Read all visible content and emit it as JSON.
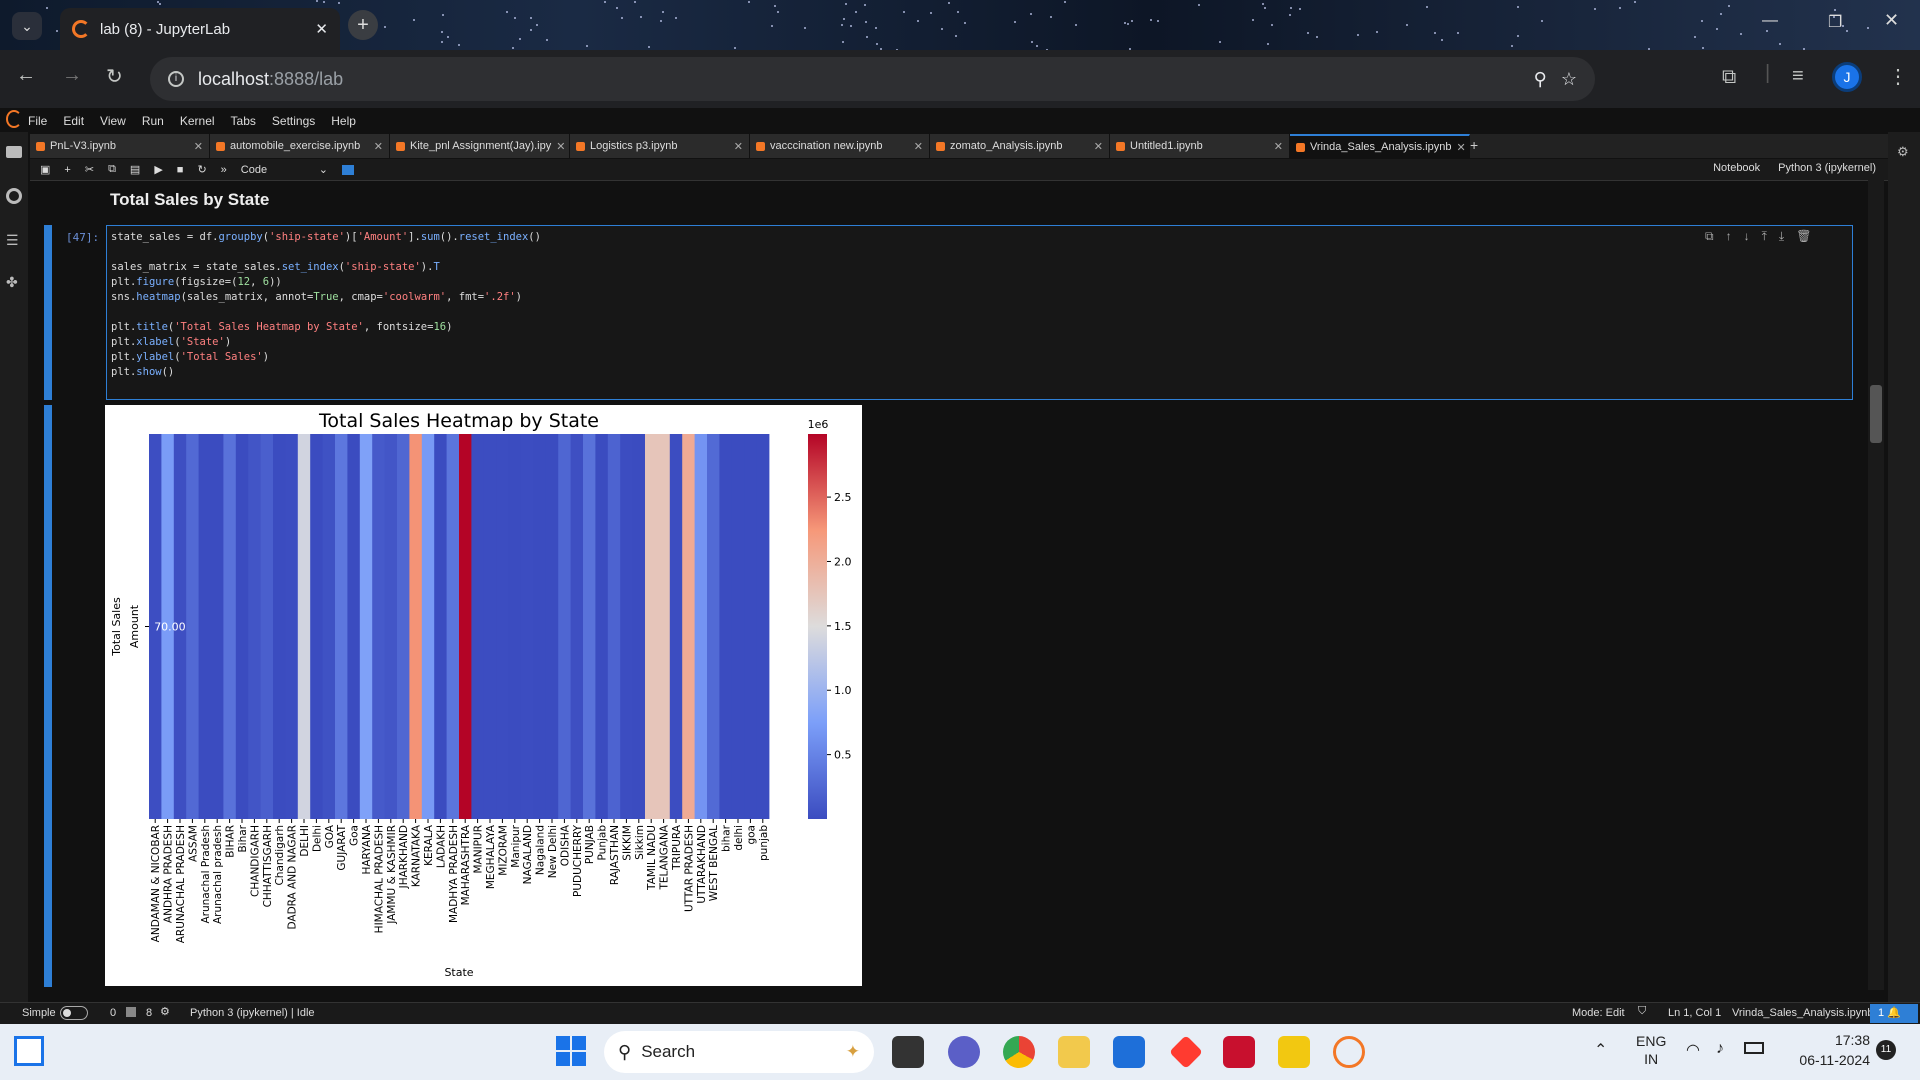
{
  "browser": {
    "tab_title": "lab (8) - JupyterLab",
    "url_host": "localhost",
    "url_rest": ":8888/lab",
    "profile_initial": "J"
  },
  "menubar": [
    "File",
    "Edit",
    "View",
    "Run",
    "Kernel",
    "Tabs",
    "Settings",
    "Help"
  ],
  "doc_tabs": [
    {
      "label": "PnL-V3.ipynb",
      "active": false
    },
    {
      "label": "automobile_exercise.ipynb",
      "active": false
    },
    {
      "label": "Kite_pnl Assignment(Jay).ipy",
      "active": false
    },
    {
      "label": "Logistics p3.ipynb",
      "active": false
    },
    {
      "label": "vacccination new.ipynb",
      "active": false
    },
    {
      "label": "zomato_Analysis.ipynb",
      "active": false
    },
    {
      "label": "Untitled1.ipynb",
      "active": false
    },
    {
      "label": "Vrinda_Sales_Analysis.ipynb",
      "active": true
    }
  ],
  "nb_toolbar": {
    "cell_type": "Code",
    "notebook_label": "Notebook",
    "kernel": "Python 3 (ipykernel)"
  },
  "notebook": {
    "heading": "Total Sales by State",
    "prompt": "[47]:",
    "code_lines": [
      "state_sales = df.groupby('ship-state')['Amount'].sum().reset_index()",
      "",
      "sales_matrix = state_sales.set_index('ship-state').T",
      "plt.figure(figsize=(12, 6))",
      "sns.heatmap(sales_matrix, annot=True, cmap='coolwarm', fmt='.2f')",
      "",
      "plt.title('Total Sales Heatmap by State', fontsize=16)",
      "plt.xlabel('State')",
      "plt.ylabel('Total Sales')",
      "plt.show()"
    ]
  },
  "chart_data": {
    "type": "heatmap",
    "title": "Total Sales Heatmap by State",
    "xlabel": "State",
    "ylabel": "Total Sales",
    "y_tick_label": "Amount",
    "annotation": "70.00",
    "colorbar_label": "1e6",
    "colorbar_ticks": [
      0.5,
      1.0,
      1.5,
      2.0,
      2.5
    ],
    "colorbar_tick_labels": [
      "0.5",
      "1.0",
      "1.5",
      "2.0",
      "2.5"
    ],
    "colormap": "coolwarm",
    "vmin": 0,
    "vmax": 2.99,
    "categories": [
      "ANDAMAN & NICOBAR",
      "ANDHRA PRADESH",
      "ARUNACHAL PRADESH",
      "ASSAM",
      "Arunachal Pradesh",
      "Arunachal pradesh",
      "BIHAR",
      "Bihar",
      "CHANDIGARH",
      "CHHATTISGARH",
      "Chandigarh",
      "DADRA AND NAGAR",
      "DELHI",
      "Delhi",
      "GOA",
      "GUJARAT",
      "Goa",
      "HARYANA",
      "HIMACHAL PRADESH",
      "JAMMU & KASHMIR",
      "JHARKHAND",
      "KARNATAKA",
      "KERALA",
      "LADAKH",
      "MADHYA PRADESH",
      "MAHARASHTRA",
      "MANIPUR",
      "MEGHALAYA",
      "MIZORAM",
      "Manipur",
      "NAGALAND",
      "Nagaland",
      "New Delhi",
      "ODISHA",
      "PUDUCHERRY",
      "PUNJAB",
      "Punjab",
      "RAJASTHAN",
      "SIKKIM",
      "Sikkim",
      "TAMIL NADU",
      "TELANGANA",
      "TRIPURA",
      "UTTAR PRADESH",
      "UTTARAKHAND",
      "WEST BENGAL",
      "bihar",
      "delhi",
      "goa",
      "punjab"
    ],
    "values": [
      0.02,
      0.72,
      0.03,
      0.26,
      0.0,
      0.0,
      0.34,
      0.0,
      0.08,
      0.17,
      0.0,
      0.01,
      1.4,
      0.0,
      0.05,
      0.39,
      0.0,
      0.77,
      0.13,
      0.09,
      0.24,
      2.27,
      0.7,
      0.0,
      0.37,
      2.99,
      0.01,
      0.01,
      0.01,
      0.0,
      0.01,
      0.0,
      0.0,
      0.23,
      0.03,
      0.34,
      0.0,
      0.21,
      0.01,
      0.0,
      1.75,
      1.75,
      0.01,
      2.04,
      0.65,
      0.27,
      0.0,
      0.0,
      0.0,
      0.0
    ]
  },
  "statusbar": {
    "mode_label": "Simple",
    "counts_a": "0",
    "counts_b": "8",
    "kernel_status": "Python 3 (ipykernel) | Idle",
    "mode": "Mode: Edit",
    "cursor": "Ln 1, Col 1",
    "filename": "Vrinda_Sales_Analysis.ipynb",
    "notifications": "1"
  },
  "taskbar": {
    "search_placeholder": "Search",
    "lang_top": "ENG",
    "lang_bottom": "IN",
    "time": "17:38",
    "date": "06-11-2024",
    "badge": "11"
  },
  "colors": {
    "accent": "#2e7fd6",
    "jupyter_orange": "#f37726"
  }
}
